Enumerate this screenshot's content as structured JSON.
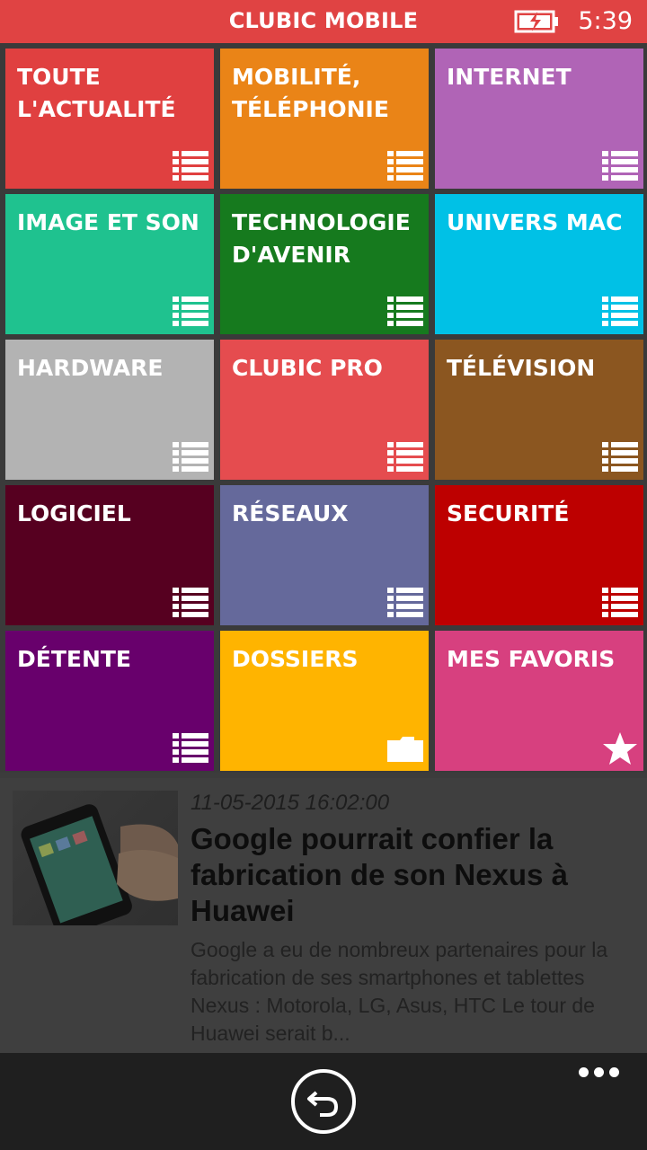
{
  "header": {
    "title": "CLUBIC MOBILE",
    "time": "5:39",
    "battery_icon": "battery-charging-icon"
  },
  "tiles": [
    {
      "label": "TOUTE\nL'ACTUALITÉ",
      "color": "#e04040",
      "icon": "list-icon"
    },
    {
      "label": "MOBILITÉ,\nTÉLÉPHONIE",
      "color": "#ea8417",
      "icon": "list-icon"
    },
    {
      "label": "INTERNET",
      "color": "#b064b6",
      "icon": "list-icon"
    },
    {
      "label": "IMAGE ET SON",
      "color": "#1fc28f",
      "icon": "list-icon"
    },
    {
      "label": "TECHNOLOGIE\nD'AVENIR",
      "color": "#167a1e",
      "icon": "list-icon"
    },
    {
      "label": "UNIVERS MAC",
      "color": "#00c1e6",
      "icon": "list-icon"
    },
    {
      "label": "HARDWARE",
      "color": "#b3b3b3",
      "icon": "list-icon"
    },
    {
      "label": "CLUBIC PRO",
      "color": "#e54c4f",
      "icon": "list-icon"
    },
    {
      "label": "TÉLÉVISION",
      "color": "#8b5620",
      "icon": "list-icon"
    },
    {
      "label": "LOGICIEL",
      "color": "#560020",
      "icon": "list-icon"
    },
    {
      "label": "RÉSEAUX",
      "color": "#65699b",
      "icon": "list-icon"
    },
    {
      "label": "SECURITÉ",
      "color": "#bd0000",
      "icon": "list-icon"
    },
    {
      "label": "DÉTENTE",
      "color": "#68006c",
      "icon": "list-icon"
    },
    {
      "label": "DOSSIERS",
      "color": "#ffb400",
      "icon": "folder-icon"
    },
    {
      "label": "MES FAVORIS",
      "color": "#d7407f",
      "icon": "star-icon"
    }
  ],
  "article": {
    "date": "11-05-2015 16:02:00",
    "title": "Google pourrait confier la fabrication de son Nexus à Huawei",
    "summary": "Google a eu de nombreux partenaires pour la fabrication de ses smartphones et tablettes Nexus : Motorola, LG, Asus, HTC Le tour de Huawei serait b..."
  },
  "appbar": {
    "back_icon": "back-arrow-icon",
    "more_icon": "more-dots-icon"
  }
}
